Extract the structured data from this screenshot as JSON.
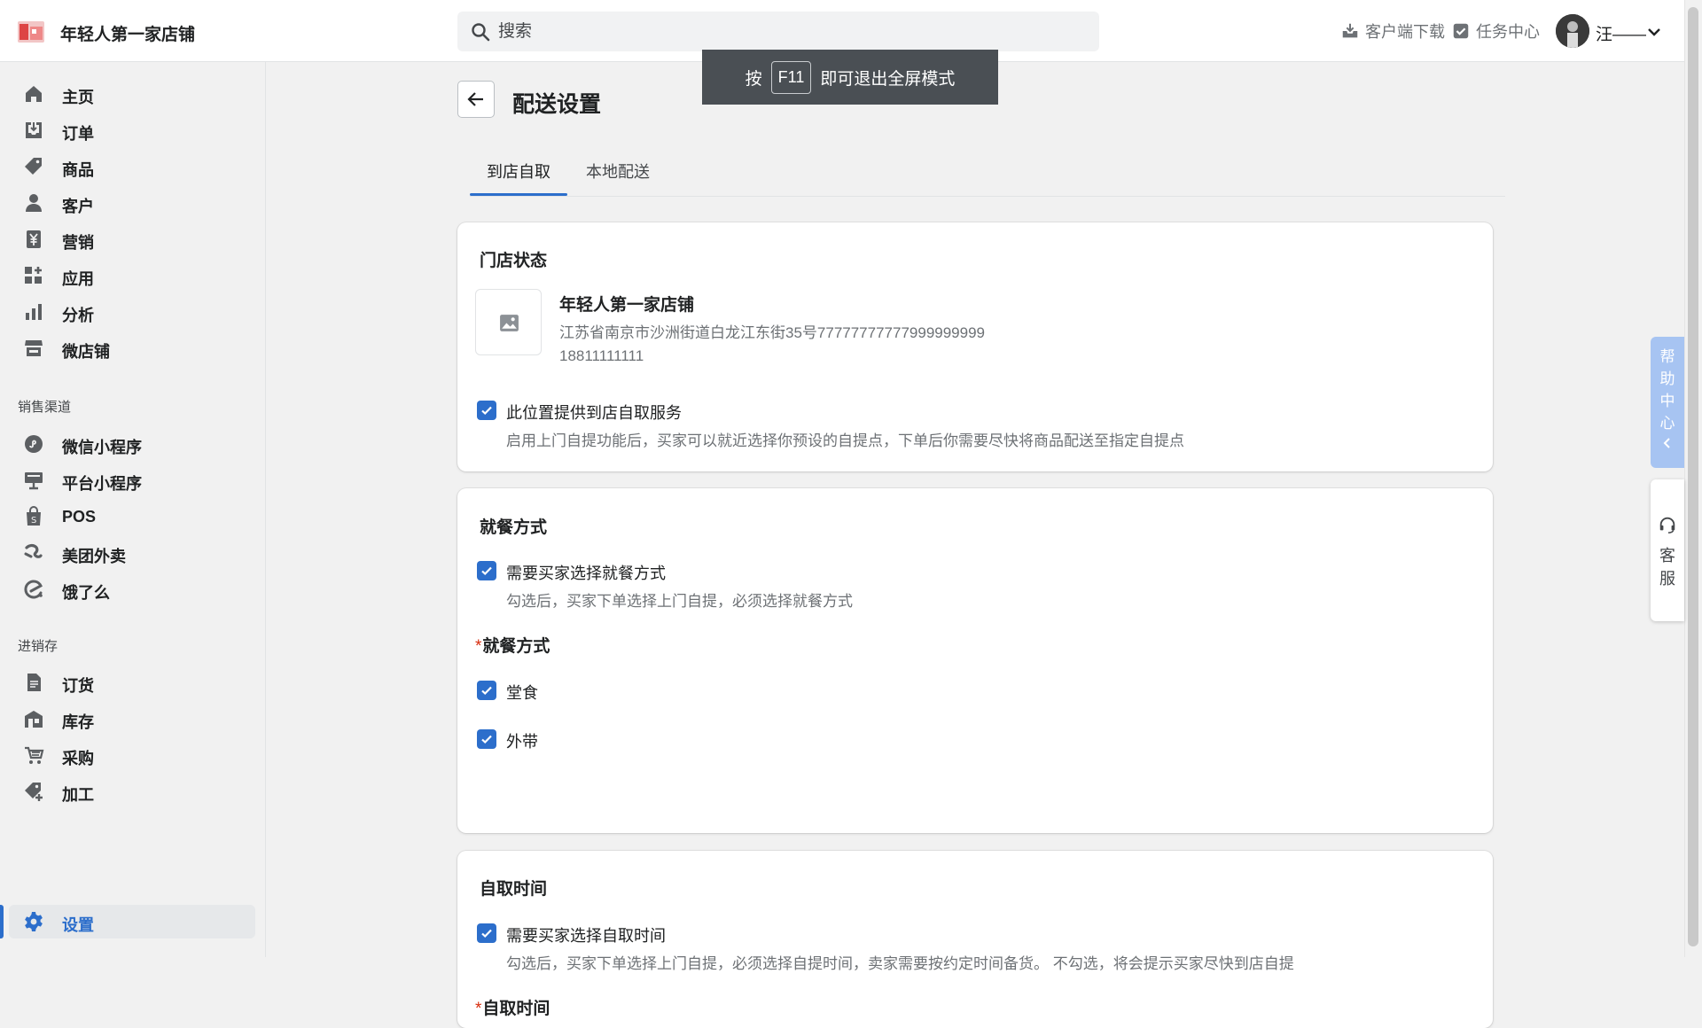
{
  "header": {
    "store_name": "年轻人第一家店铺",
    "search_placeholder": "搜索",
    "client_download": "客户端下载",
    "task_center": "任务中心",
    "user_name": "汪——"
  },
  "toast": {
    "prefix": "按",
    "key": "F11",
    "suffix": "即可退出全屏模式"
  },
  "sidebar": {
    "items": [
      {
        "label": "主页",
        "icon": "home-icon"
      },
      {
        "label": "订单",
        "icon": "order-inbox-icon"
      },
      {
        "label": "商品",
        "icon": "tag-icon"
      },
      {
        "label": "客户",
        "icon": "person-icon"
      },
      {
        "label": "营销",
        "icon": "yen-icon"
      },
      {
        "label": "应用",
        "icon": "apps-icon"
      },
      {
        "label": "分析",
        "icon": "bar-chart-icon"
      },
      {
        "label": "微店铺",
        "icon": "storefront-icon"
      }
    ],
    "sales_section": "销售渠道",
    "sales_items": [
      {
        "label": "微信小程序",
        "icon": "wechat-mini-icon"
      },
      {
        "label": "平台小程序",
        "icon": "platform-mini-icon"
      },
      {
        "label": "POS",
        "icon": "pos-bag-icon"
      },
      {
        "label": "美团外卖",
        "icon": "meituan-icon"
      },
      {
        "label": "饿了么",
        "icon": "eleme-icon"
      }
    ],
    "inventory_section": "进销存",
    "inventory_items": [
      {
        "label": "订货",
        "icon": "document-icon"
      },
      {
        "label": "库存",
        "icon": "warehouse-icon"
      },
      {
        "label": "采购",
        "icon": "purchase-cart-icon"
      },
      {
        "label": "加工",
        "icon": "tag-plus-icon"
      }
    ],
    "settings": "设置"
  },
  "page": {
    "title": "配送设置",
    "tabs": [
      "到店自取",
      "本地配送"
    ],
    "active_tab": "到店自取"
  },
  "store_status": {
    "title": "门店状态",
    "name": "年轻人第一家店铺",
    "address": "江苏省南京市沙洲街道白龙江东街35号77777777777999999999",
    "phone": "18811111111",
    "pickup_checked": true,
    "pickup_label": "此位置提供到店自取服务",
    "pickup_help": "启用上门自提功能后，买家可以就近选择你预设的自提点，下单后你需要尽快将商品配送至指定自提点"
  },
  "dining": {
    "title": "就餐方式",
    "require_checked": true,
    "require_label": "需要买家选择就餐方式",
    "require_help": "勾选后，买家下单选择上门自提，必须选择就餐方式",
    "options_label": "就餐方式",
    "options": [
      {
        "label": "堂食",
        "checked": true
      },
      {
        "label": "外带",
        "checked": true
      }
    ]
  },
  "pickup_time": {
    "title": "自取时间",
    "require_checked": true,
    "require_label": "需要买家选择自取时间",
    "require_help": "勾选后，买家下单选择上门自提，必须选择自提时间，卖家需要按约定时间备货。 不勾选，将会提示买家尽快到店自提",
    "time_label": "自取时间"
  },
  "side_tabs": {
    "help": [
      "帮",
      "助",
      "中",
      "心"
    ],
    "service": [
      "客",
      "服"
    ]
  },
  "colors": {
    "accent": "#2c6ecb",
    "required": "#d72c0d"
  }
}
